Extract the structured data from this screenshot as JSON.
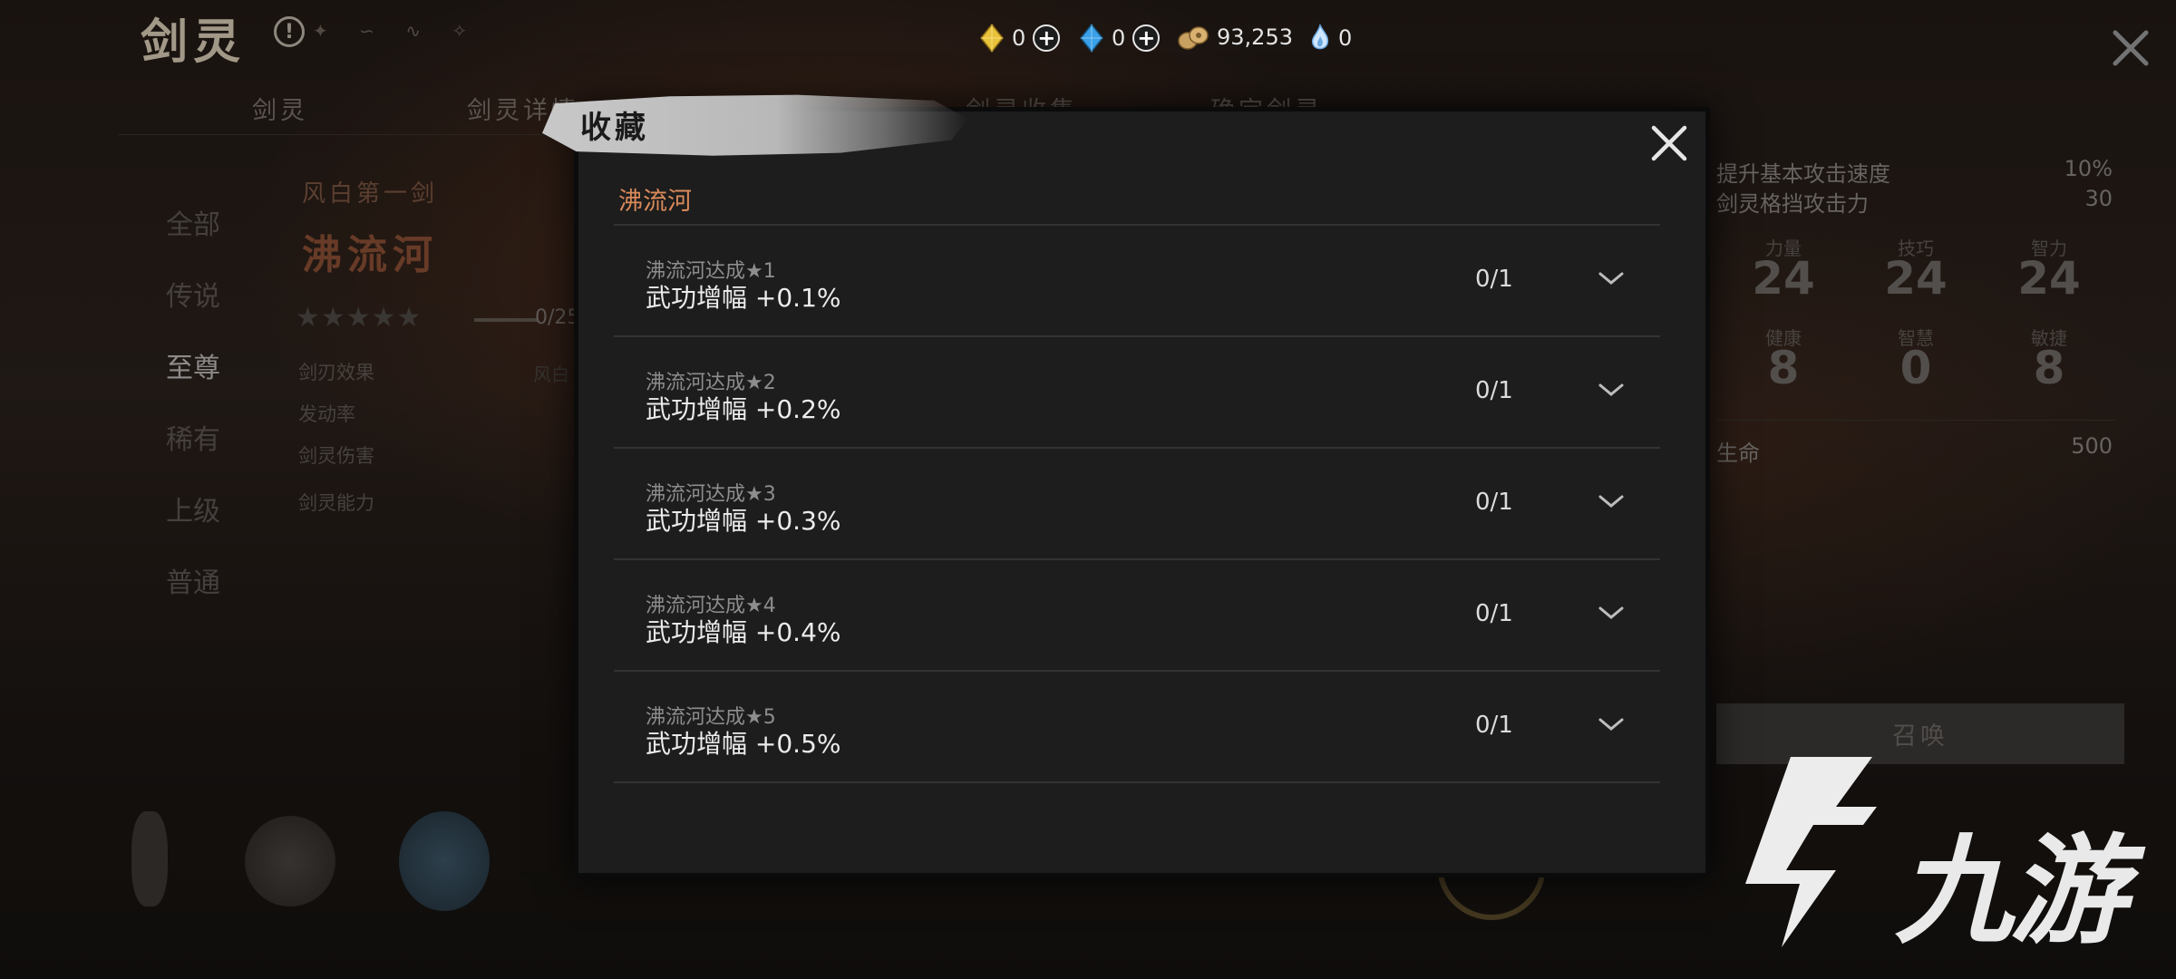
{
  "page": {
    "title": "剑灵",
    "title_deco": "✦ ∽ ∿ ✧",
    "tabs": [
      "剑灵",
      "剑灵详情",
      "剑灵收集",
      "确定剑灵"
    ]
  },
  "currency": [
    {
      "icon": "gold-diamond-icon",
      "value": "0",
      "has_plus": true
    },
    {
      "icon": "blue-diamond-icon",
      "value": "0",
      "has_plus": true
    },
    {
      "icon": "coin-pile-icon",
      "value": "93,253",
      "has_plus": false
    },
    {
      "icon": "blue-flame-icon",
      "value": "0",
      "has_plus": false
    }
  ],
  "categories": [
    "全部",
    "传说",
    "至尊",
    "稀有",
    "上级",
    "普通"
  ],
  "active_category": "至尊",
  "sword": {
    "subtitle": "风白第一剑",
    "name": "沸流河",
    "stars_filled": 0,
    "stars_total": 5,
    "progress_text": "0/25",
    "labels": [
      "剑刃效果",
      "发动率",
      "剑灵伤害",
      "剑灵能力"
    ],
    "effect_partial": "风白"
  },
  "stats": {
    "lines": [
      {
        "label": "提升基本攻击速度",
        "value": "10%"
      },
      {
        "label": "剑灵格挡攻击力",
        "value": "30"
      }
    ],
    "attributes": [
      {
        "label": "力量",
        "value": "24"
      },
      {
        "label": "技巧",
        "value": "24"
      },
      {
        "label": "智力",
        "value": "24"
      },
      {
        "label": "健康",
        "value": "8"
      },
      {
        "label": "智慧",
        "value": "0"
      },
      {
        "label": "敏捷",
        "value": "8"
      }
    ],
    "life_label": "生命",
    "life_value": "500",
    "summon_label": "召唤"
  },
  "modal": {
    "title": "收藏",
    "section": "沸流河",
    "rows": [
      {
        "sub": "沸流河达成★1",
        "main": "武功增幅 +0.1%",
        "progress": "0/1"
      },
      {
        "sub": "沸流河达成★2",
        "main": "武功增幅 +0.2%",
        "progress": "0/1"
      },
      {
        "sub": "沸流河达成★3",
        "main": "武功增幅 +0.3%",
        "progress": "0/1"
      },
      {
        "sub": "沸流河达成★4",
        "main": "武功增幅 +0.4%",
        "progress": "0/1"
      },
      {
        "sub": "沸流河达成★5",
        "main": "武功增幅 +0.5%",
        "progress": "0/1"
      }
    ]
  },
  "watermark": {
    "text": "九游"
  },
  "colors": {
    "accent_orange": "#d98a5a",
    "modal_bg": "#1d1d1d",
    "gold": "#e8c23a",
    "blue": "#3aa0e8"
  }
}
